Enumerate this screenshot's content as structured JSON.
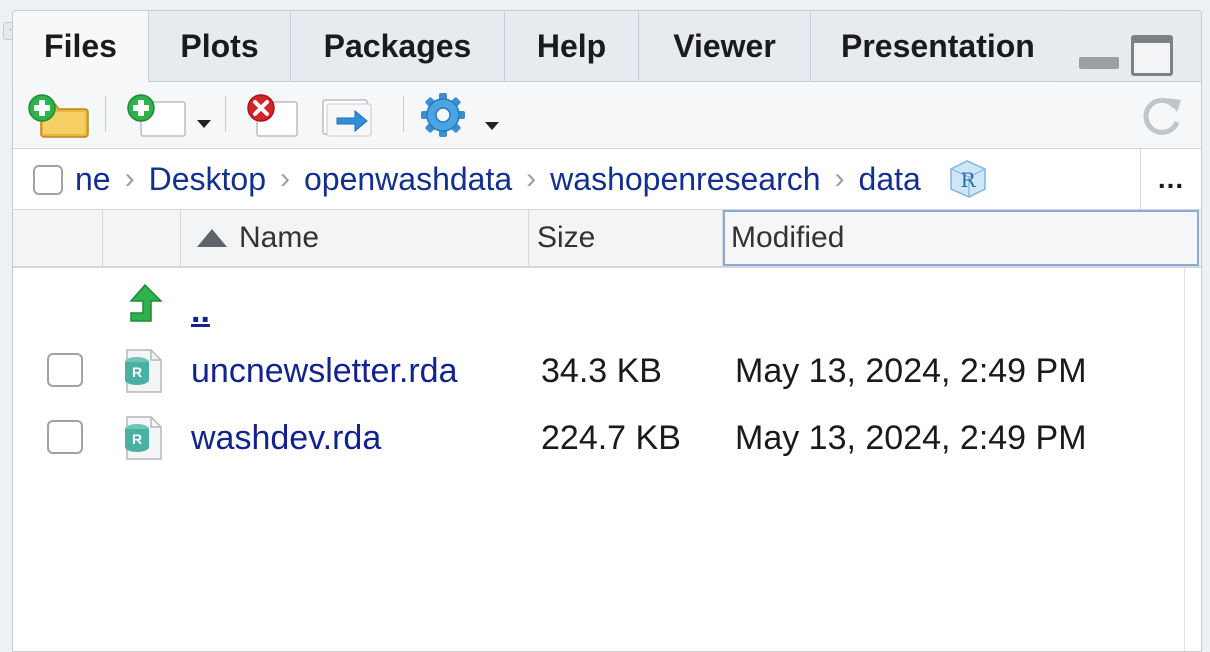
{
  "tabs": [
    {
      "label": "Files",
      "active": true
    },
    {
      "label": "Plots",
      "active": false
    },
    {
      "label": "Packages",
      "active": false
    },
    {
      "label": "Help",
      "active": false
    },
    {
      "label": "Viewer",
      "active": false
    },
    {
      "label": "Presentation",
      "active": false
    }
  ],
  "toolbar": {
    "icons": [
      "new-folder-icon",
      "new-blank-file-icon",
      "delete-icon",
      "rename-icon",
      "gear-icon",
      "refresh-icon"
    ]
  },
  "breadcrumb": {
    "items": [
      "ne",
      "Desktop",
      "openwashdata",
      "washopenresearch",
      "data"
    ],
    "more_label": "..."
  },
  "columns": {
    "name": "Name",
    "size": "Size",
    "modified": "Modified",
    "sort": "name-ascending"
  },
  "updir": {
    "label": ".."
  },
  "files": [
    {
      "name": "uncnewsletter.rda",
      "size": "34.3 KB",
      "modified": "May 13, 2024, 2:49 PM"
    },
    {
      "name": "washdev.rda",
      "size": "224.7 KB",
      "modified": "May 13, 2024, 2:49 PM"
    }
  ],
  "colors": {
    "link": "#12228f",
    "header_focus": "#8ea9d8",
    "green": "#2fb24c",
    "red": "#d4242a",
    "blue": "#2f8fd8"
  }
}
